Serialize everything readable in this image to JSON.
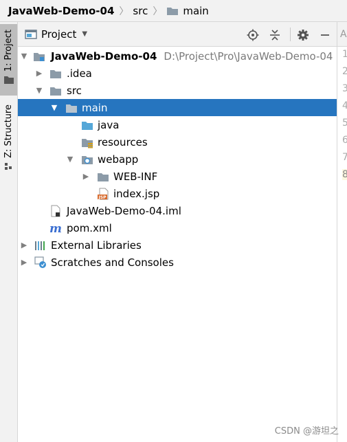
{
  "breadcrumb": {
    "project": "JavaWeb-Demo-04",
    "src": "src",
    "main": "main"
  },
  "toolstrip": {
    "project_tab": "1: Project",
    "structure_tab": "Z: Structure"
  },
  "panel": {
    "title": "Project",
    "header_icons": [
      "locate-icon",
      "collapse-all-icon",
      "gear-icon",
      "hide-icon"
    ]
  },
  "tree": {
    "root_name": "JavaWeb-Demo-04",
    "root_path": "D:\\Project\\Pro\\JavaWeb-Demo-04",
    "idea": ".idea",
    "src": "src",
    "main": "main",
    "java": "java",
    "resources": "resources",
    "webapp": "webapp",
    "webinf": "WEB-INF",
    "indexjsp": "index.jsp",
    "iml": "JavaWeb-Demo-04.iml",
    "pom": "pom.xml",
    "extlibs": "External Libraries",
    "scratches": "Scratches and Consoles"
  },
  "gutter": {
    "tab_glyph": "A",
    "line_numbers": [
      "1",
      "2",
      "3",
      "4",
      "5",
      "6",
      "7",
      "8"
    ]
  },
  "watermark": "CSDN @游坦之",
  "colors": {
    "selection": "#2675bf",
    "folder": "#8c9ba8",
    "source_folder": "#55a7d8",
    "jsp_badge": "#d8692b"
  }
}
